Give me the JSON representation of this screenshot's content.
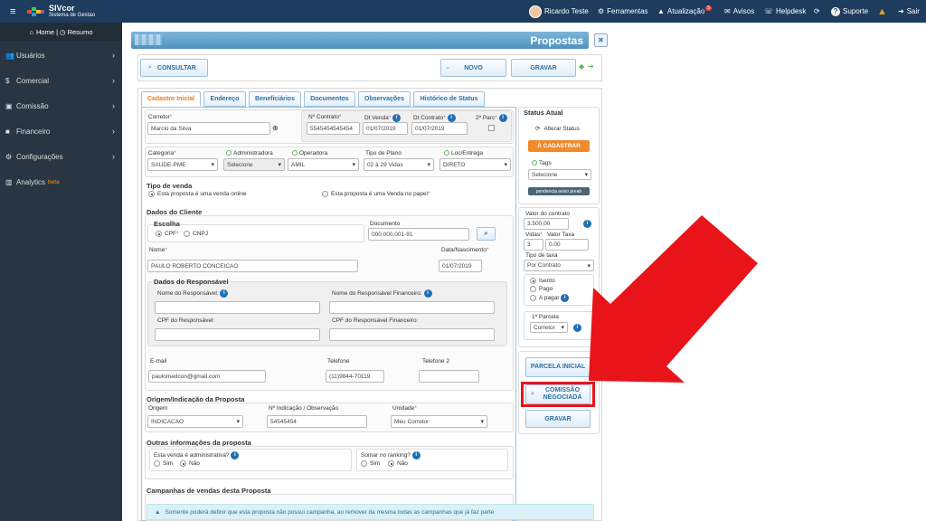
{
  "topbar": {
    "logo_name": "SIVcor",
    "logo_sub": "Sistema de Gestao",
    "user": "Ricardo Teste",
    "tools": "Ferramentas",
    "update": "Atualização",
    "update_badge": "5",
    "avisos": "Avisos",
    "helpdesk": "Helpdesk",
    "suporte": "Suporte",
    "sair": "Sair"
  },
  "sidebar": {
    "home": "Home | ",
    "resumo": "Resumo",
    "items": [
      {
        "label": "Usuários"
      },
      {
        "label": "Comercial"
      },
      {
        "label": "Comissão"
      },
      {
        "label": "Financeiro"
      },
      {
        "label": "Configurações"
      },
      {
        "label": "Analytics"
      }
    ],
    "beta": "beta"
  },
  "page": {
    "title": "Propostas",
    "close": "✖"
  },
  "toolbar": {
    "consultar": "CONSULTAR",
    "novo": "NOVO",
    "gravar": "GRAVAR"
  },
  "tabs": [
    "Cadastro Inicial",
    "Endereço",
    "Beneficiários",
    "Documentos",
    "Observações",
    "Histórico de Status"
  ],
  "form": {
    "corretor_label": "Corretor",
    "corretor_value": "Marcio da Silva",
    "contrato_label": "Nº Contrato",
    "contrato_value": "5545454545454",
    "dt_venda_label": "Dt Venda",
    "dt_venda_value": "01/07/2019",
    "dt_contrato_label": "Dt Contrato",
    "dt_contrato_value": "01/07/2019",
    "parc_label": "2ª Parc",
    "categoria_label": "Categoria",
    "categoria_value": "SAUDE-PME",
    "administradora_label": "Administradora",
    "administradora_value": "Selecione",
    "operadora_label": "Operadora",
    "operadora_value": "AMIL",
    "tipo_plano_label": "Tipo de Plano",
    "tipo_plano_value": "02 à 29 Vidas",
    "loc_label": "Loc/Entrega",
    "loc_value": "DIRETO",
    "tipo_venda_title": "Tipo de venda",
    "venda_online": "Esta proposta é uma venda online",
    "venda_papel": "Esta proposta é uma Venda no papel",
    "dados_cliente_title": "Dados do Cliente",
    "escolha": "Escolha",
    "cpf": "CPF",
    "cnpj": "CNPJ",
    "documento_label": "Documento",
    "documento_value": "000.000.001-91",
    "nome_label": "Nome",
    "nome_value": "PAULO ROBERTO CONCEICAO",
    "nasc_label": "Data/Nascimento",
    "nasc_value": "01/07/2019",
    "responsavel_title": "Dados do Responsável",
    "nome_resp": "Nome do Responsável:",
    "nome_resp_fin": "Nome do Responsável Financeiro:",
    "cpf_resp": "CPF do Responsável:",
    "cpf_resp_fin": "CPF do Responsável Financeiro:",
    "email_label": "E-mail",
    "email_value": "paulomedcon@gmail.com",
    "telefone_label": "Telefone",
    "telefone_value": "(11)9844-70119",
    "telefone2_label": "Telefone 2",
    "origem_title": "Origem/Indicação da Proposta",
    "origem_label": "Origem",
    "origem_value": "INDICACAO",
    "indicacao_label": "Nº Indicação / Observação",
    "indicacao_value": "54545454",
    "unidade_label": "Unidade",
    "unidade_value": "Meu Corretor",
    "outras_title": "Outras informações da proposta",
    "administrativa": "Esta venda é administrativa?",
    "ranking": "Somar no ranking?",
    "sim": "Sim",
    "nao": "Não",
    "campanhas_title": "Campanhas de vendas desta Proposta",
    "campanhas_alert": "Somente poderá definir que esta proposta não possui campanha, ao remover da mesma todas as campanhas que já faz parte"
  },
  "status": {
    "title": "Status Atual",
    "alterar": "Alterar Status",
    "badge": "À CADASTRAR",
    "tags": "Tags",
    "tags_value": "Selecione",
    "pendencia": "pendencia aviso preab"
  },
  "valores": {
    "valor_label": "Valor do contrato",
    "valor_value": "3.500,00",
    "vidas_label": "Vidas",
    "vidas_value": "3",
    "taxa_label": "Valor Taxa",
    "taxa_value": "0.00",
    "tipo_taxa_label": "Tipo de taxa",
    "tipo_taxa_value": "Por Contrato",
    "isento": "Isento",
    "pago": "Pago",
    "a_pagar": "A pagar",
    "parcela_label": "1ª Parcela",
    "parcela_value": "Corretor"
  },
  "side_buttons": {
    "parcela_inicial": "PARCELA INICIAL",
    "comissao_negociada": "COMISSÃO NEGOCIADA",
    "gravar": "GRAVAR"
  },
  "colors": {
    "arrow": "#e8141a",
    "highlight": "#e8141a",
    "accent": "#f28a2b",
    "topbar": "#1d3c5e"
  }
}
